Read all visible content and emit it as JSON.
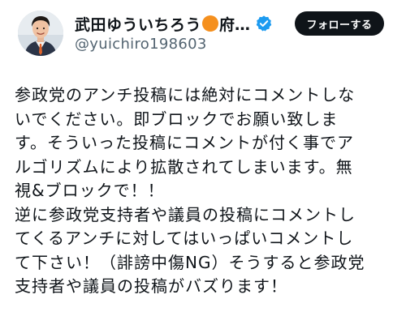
{
  "header": {
    "display_name": "武田ゆういちろう",
    "name_suffix": "府…",
    "name_emoji": "orange-circle-emoji",
    "verified_icon": "verified-badge-icon",
    "verified_color": "#1d9bf0",
    "handle": "@yuichiro198603",
    "follow_label": "フォローする"
  },
  "tweet": {
    "lines": [
      "参政党のアンチ投稿には絶対にコメントしな",
      "いでください。即ブロックでお願い致しま",
      "す。そういった投稿にコメントが付く事でア",
      "ルゴリズムにより拡散されてしまいます。無",
      "視&ブロックで！！",
      "逆に参政党支持者や議員の投稿にコメントし",
      "てくるアンチに対してはいっぱいコメントし",
      "て下さい！（誹謗中傷NG）そうすると参政党",
      "支持者や議員の投稿がバズります！"
    ]
  },
  "colors": {
    "text": "#0f1419",
    "handle": "#536471",
    "button_bg": "#0f1419",
    "button_text": "#ffffff",
    "emoji_orange": "#f5901e"
  }
}
